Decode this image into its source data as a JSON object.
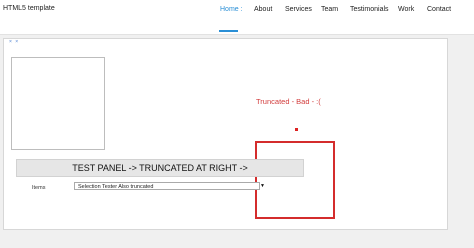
{
  "navbar": {
    "brand": "HTML5 template",
    "links": [
      {
        "label": "Home",
        "active": true,
        "suffix": " :"
      },
      {
        "label": "About"
      },
      {
        "label": "Services"
      },
      {
        "label": "Team"
      },
      {
        "label": "Testimonials"
      },
      {
        "label": "Work"
      },
      {
        "label": "Contact"
      }
    ]
  },
  "canvas": {
    "close_icons": "× ×",
    "truncated_text": "Truncated - Bad - :(",
    "test_panel_label": "TEST PANEL -> TRUNCATED AT RIGHT ->",
    "items_label": "Items",
    "select_value": "Selection Tester Also truncated",
    "colors": {
      "accent": "#2a8fd6",
      "error": "#d42c2c"
    }
  }
}
